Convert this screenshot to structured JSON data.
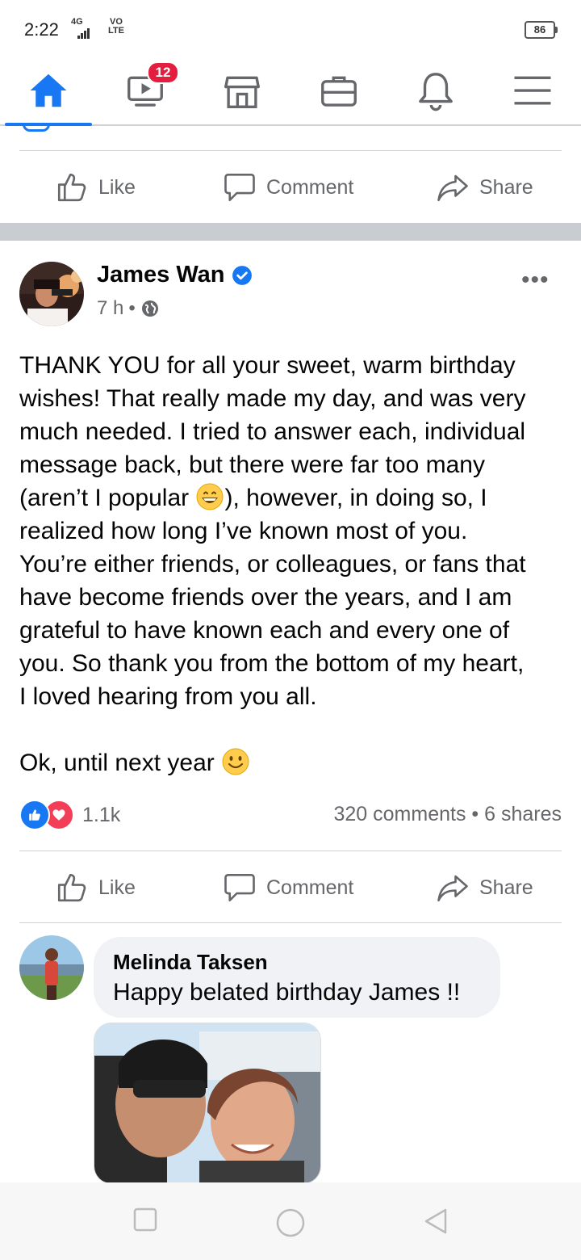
{
  "status_bar": {
    "time": "2:22",
    "network": "4G",
    "volte": "VO\nLTE",
    "battery": "86"
  },
  "nav": {
    "items": [
      "home-icon",
      "watch-icon",
      "marketplace-icon",
      "jobs-icon",
      "notifications-icon",
      "menu-icon"
    ],
    "watch_badge": "12",
    "accent": "#1877f2"
  },
  "top_actions": {
    "like": "Like",
    "comment": "Comment",
    "share": "Share"
  },
  "post": {
    "author": "James Wan",
    "time": "7 h",
    "body_lines": [
      "THANK YOU for all your sweet, warm birthday",
      "wishes! That really made my day, and was very",
      "much needed. I tried to answer each, individual",
      "message back, but there were far too many"
    ],
    "line5_pre": "(aren’t I popular ",
    "line5_post": "), however, in doing so, I",
    "body_lines_2": [
      "realized how long I’ve known most of you.",
      "You’re either friends, or colleagues, or fans that",
      "have become friends over the years, and I am",
      "grateful to have known each and every one of",
      "you. So thank you from the bottom of my heart,",
      "I loved hearing from you all."
    ],
    "closing": "Ok, until next year ",
    "reaction_count": "1.1k",
    "stats": "320 comments • 6 shares",
    "actions": {
      "like": "Like",
      "comment": "Comment",
      "share": "Share"
    }
  },
  "comment": {
    "name": "Melinda Taksen",
    "text": "Happy belated birthday James !!"
  },
  "colors": {
    "brand": "#1877f2",
    "love": "#f33e58",
    "badge": "#e41e3f",
    "secondary_text": "#65676b"
  }
}
